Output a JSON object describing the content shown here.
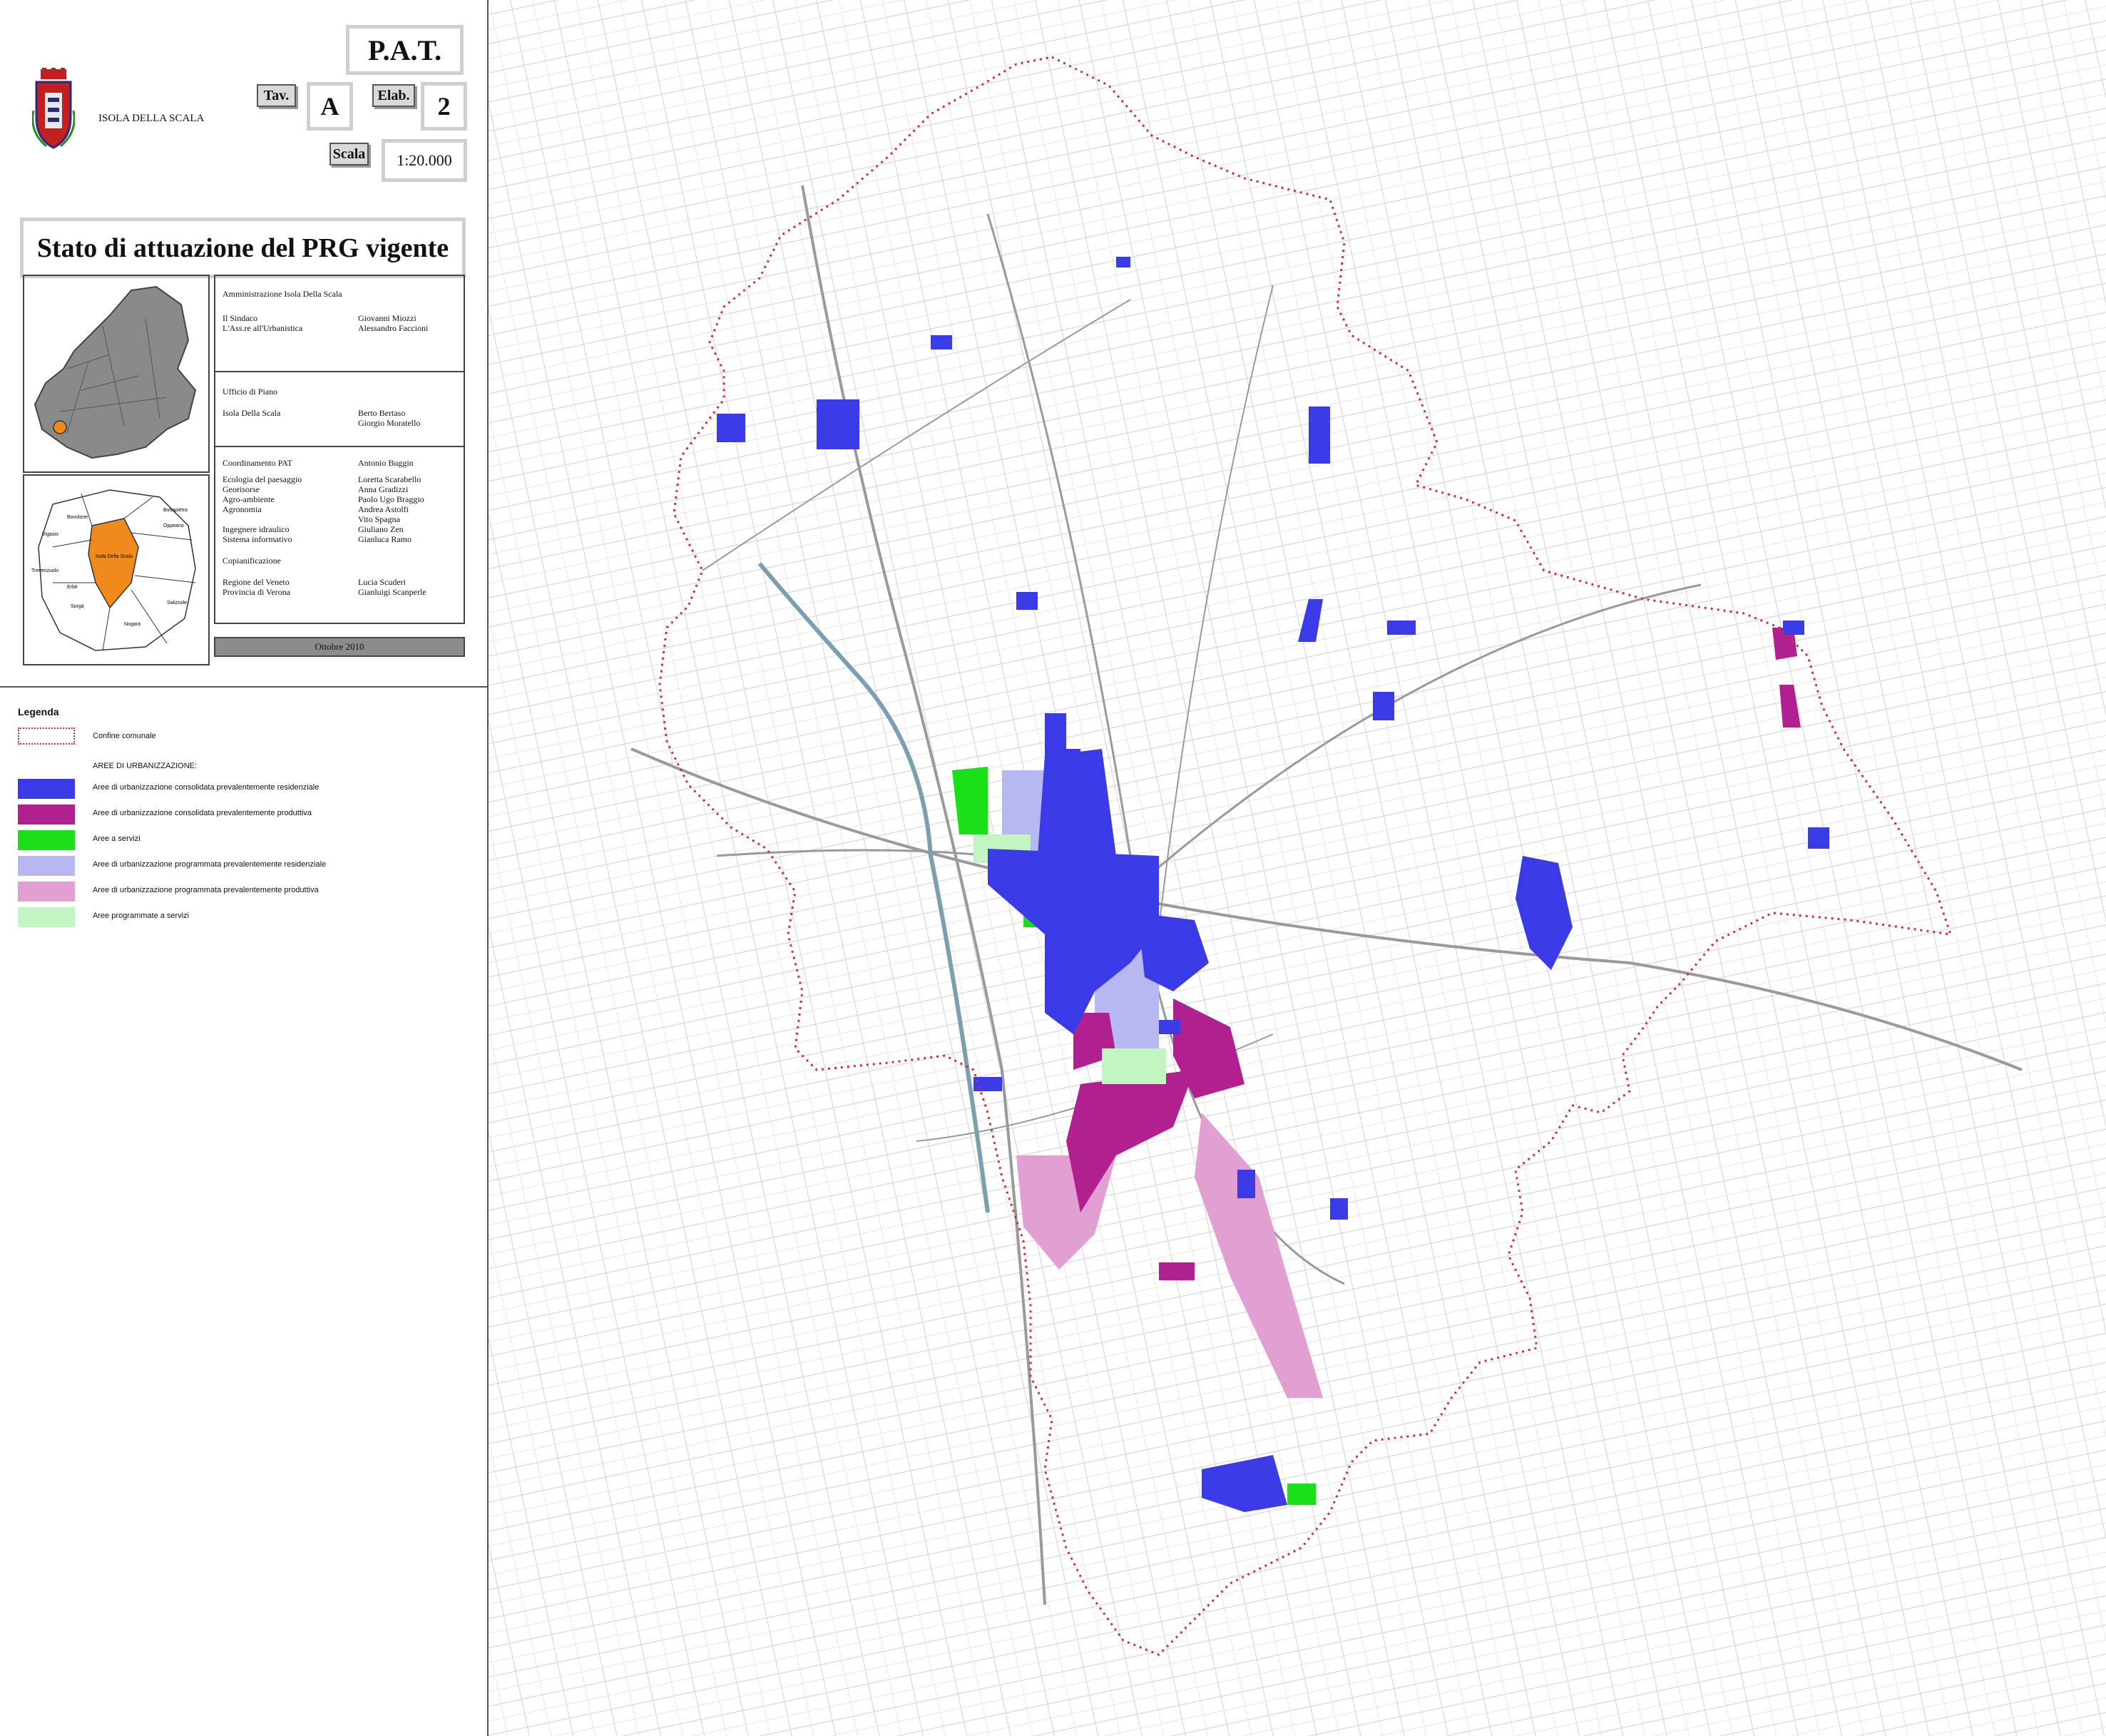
{
  "header": {
    "municipality": "ISOLA DELLA SCALA",
    "pat": "P.A.T.",
    "tav_label": "Tav.",
    "tav_value": "A",
    "elab_label": "Elab.",
    "elab_value": "2",
    "scala_label": "Scala",
    "scala_value": "1:20.000"
  },
  "title": "Stato di attuazione del PRG vigente",
  "credits": {
    "amministrazione": "Amministrazione Isola Della Scala",
    "sindaco_role": "Il Sindaco",
    "sindaco_name": "Giovanni Miozzi",
    "assessore_role": "L'Ass.re all'Urbanistica",
    "assessore_name": "Alessandro Faccioni",
    "ufficio": "Ufficio di Piano",
    "ufficio_place": "Isola Della Scala",
    "ufficio_name_1": "Berto Bertaso",
    "ufficio_name_2": "Giorgio Moratello",
    "coord_role": "Coordinamento PAT",
    "coord_name": "Antonio Buggin",
    "roles": [
      "Ecologia del paesaggio",
      "Georisorse",
      "Agro-ambiente",
      "Agronomia",
      "",
      "Ingegnere idraulico",
      "Sistema informativo"
    ],
    "names": [
      "Loretta Scarabello",
      "Anna Gradizzi",
      "Paolo Ugo Braggio",
      "Andrea Astolfi",
      "Vito Spagna",
      "Giuliano Zen",
      "Gianluca Ramo"
    ],
    "copian": "Copianificazione",
    "regione": "Regione del Veneto",
    "regione_name": "Lucia Scuderi",
    "provincia": "Provincia di Verona",
    "provincia_name": "Gianluigi Scanperle",
    "date": "Ottobre 2010"
  },
  "inset_labels": [
    "Bovolone",
    "Oppeano",
    "Vigasio",
    "Trevenzuolo",
    "Isola Della Scala",
    "Erbè",
    "Buttapietra",
    "Salizzole",
    "Sorgà",
    "Nogara"
  ],
  "legend": {
    "title": "Legenda",
    "boundary": "Confine comunale",
    "section": "AREE DI URBANIZZAZIONE:",
    "items": [
      {
        "label": "Aree di urbanizzazione consolidata prevalentemente residenziale",
        "color": "#3a3ae6"
      },
      {
        "label": "Aree di urbanizzazione consolidata prevalentemente produttiva",
        "color": "#b0208f"
      },
      {
        "label": "Aree a servizi",
        "color": "#19e019"
      },
      {
        "label": "Aree di urbanizzazione programmata prevalentemente residenziale",
        "color": "#b7b7f2"
      },
      {
        "label": "Aree di urbanizzazione programmata prevalentemente produttiva",
        "color": "#e29fd2"
      },
      {
        "label": "Aree programmate a servizi",
        "color": "#c2f5c2"
      }
    ]
  },
  "colors": {
    "boundary": "#d03030",
    "inset_highlight": "#f08a1c",
    "veneto": "#8a8a8a"
  }
}
